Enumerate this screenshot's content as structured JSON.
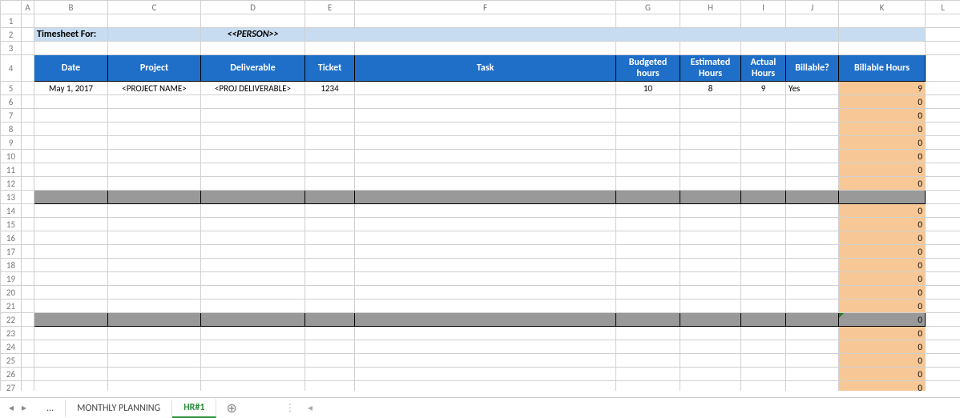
{
  "columns": [
    "A",
    "B",
    "C",
    "D",
    "E",
    "F",
    "G",
    "H",
    "I",
    "J",
    "K",
    "L"
  ],
  "title": {
    "label": "Timesheet For:",
    "person": "<<PERSON>>"
  },
  "headers": {
    "date": "Date",
    "project": "Project",
    "deliverable": "Deliverable",
    "ticket": "Ticket",
    "task": "Task",
    "budgeted": "Budgeted hours",
    "estimated": "Estimated Hours",
    "actual": "Actual Hours",
    "billable": "Billable?",
    "billable_hours": "Billable Hours"
  },
  "rows": [
    {
      "r": 5,
      "date": "May 1, 2017",
      "project": "<PROJECT NAME>",
      "deliverable": "<PROJ DELIVERABLE>",
      "ticket": "1234",
      "task": "",
      "budgeted": "10",
      "estimated": "8",
      "actual": "9",
      "billable": "Yes",
      "billable_hours": "9"
    },
    {
      "r": 6,
      "billable_hours": "0"
    },
    {
      "r": 7,
      "billable_hours": "0"
    },
    {
      "r": 8,
      "billable_hours": "0"
    },
    {
      "r": 9,
      "billable_hours": "0"
    },
    {
      "r": 10,
      "billable_hours": "0"
    },
    {
      "r": 11,
      "billable_hours": "0"
    },
    {
      "r": 12,
      "billable_hours": "0"
    },
    {
      "r": 13,
      "section": true
    },
    {
      "r": 14,
      "billable_hours": "0"
    },
    {
      "r": 15,
      "billable_hours": "0"
    },
    {
      "r": 16,
      "billable_hours": "0"
    },
    {
      "r": 17,
      "billable_hours": "0"
    },
    {
      "r": 18,
      "billable_hours": "0"
    },
    {
      "r": 19,
      "billable_hours": "0"
    },
    {
      "r": 20,
      "billable_hours": "0"
    },
    {
      "r": 21,
      "billable_hours": "0"
    },
    {
      "r": 22,
      "section": true,
      "billable_hours": "0",
      "triangle": true
    },
    {
      "r": 23,
      "billable_hours": "0"
    },
    {
      "r": 24,
      "billable_hours": "0"
    },
    {
      "r": 25,
      "billable_hours": "0"
    },
    {
      "r": 26,
      "billable_hours": "0"
    },
    {
      "r": 27,
      "billable_hours": "0"
    }
  ],
  "tabs": {
    "ellipsis": "...",
    "items": [
      {
        "label": "MONTHLY PLANNING",
        "active": false
      },
      {
        "label": "HR#1",
        "active": true
      }
    ],
    "prev": "◂",
    "next": "▸",
    "add": "⊕",
    "tightgrip": "⋮",
    "scroll_left": "◂"
  }
}
